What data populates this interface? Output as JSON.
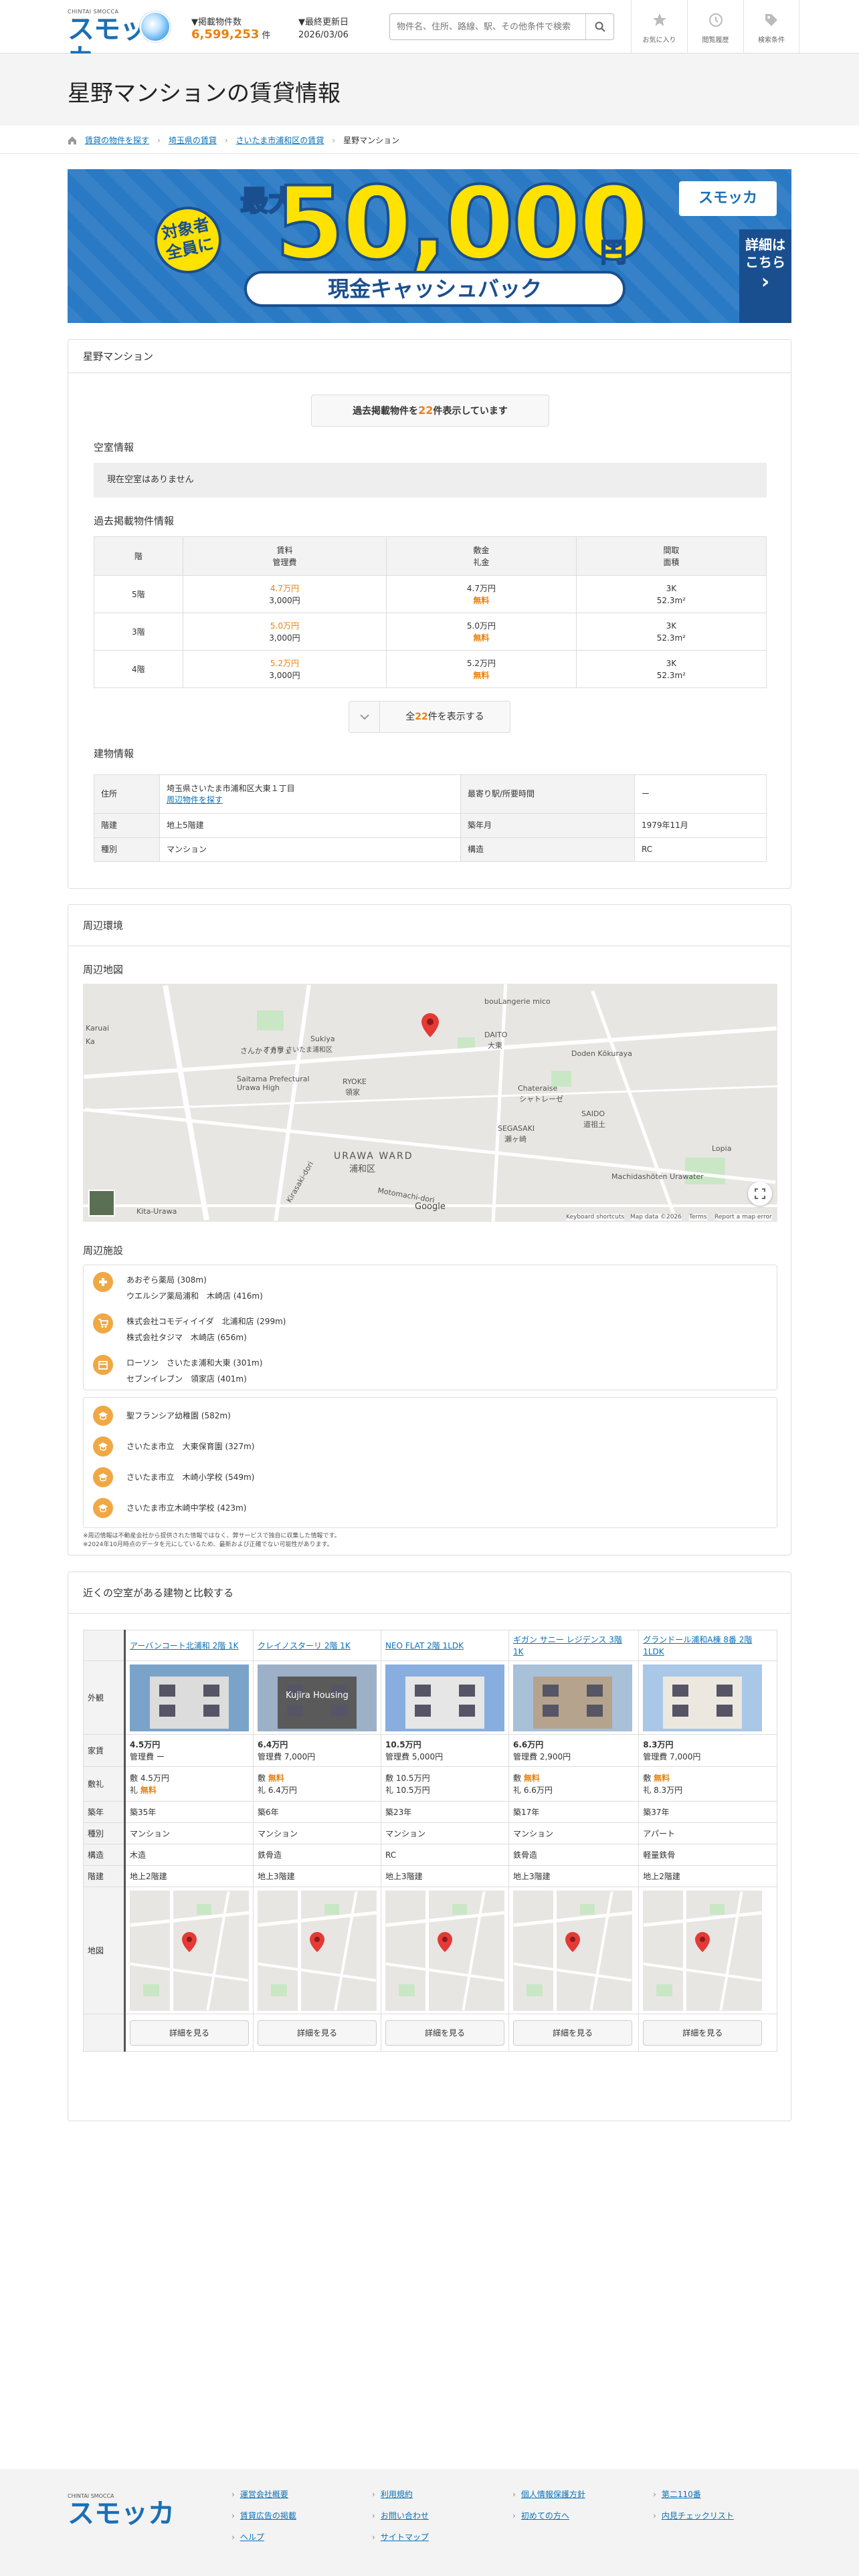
{
  "header": {
    "logo_small": "CHINTAI SMOCCA",
    "logo_text": "スモッカ",
    "count_label": "▼掲載物件数",
    "count_value": "6,599,253",
    "count_unit": "件",
    "updated_label": "▼最終更新日",
    "updated_date": "2026/03/06",
    "search_placeholder": "物件名、住所、路線、駅、その他条件で検索",
    "btn_favorites": "お気に入り",
    "btn_history": "閲覧履歴",
    "btn_conditions": "検索条件"
  },
  "page_title": "星野マンションの賃貸情報",
  "breadcrumb": [
    "賃貸の物件を探す",
    "埼玉県の賃貸",
    "さいたま市浦和区の賃貸",
    "星野マンション"
  ],
  "banner": {
    "badge": "対象者\n全員に",
    "max": "最大",
    "amount": "50,000",
    "yen": "円",
    "cash": "現金キャッシュバック",
    "logo": "スモッカ",
    "more": "詳細は\nこちら"
  },
  "building": {
    "title": "星野マンション",
    "past_pre": "過去掲載物件を",
    "past_count": "22",
    "past_post": "件表示しています",
    "vacancy_heading": "空室情報",
    "no_vacancy": "現在空室はありません",
    "past_heading": "過去掲載物件情報",
    "table_headers": [
      [
        "階"
      ],
      [
        "賃料",
        "管理費"
      ],
      [
        "敷金",
        "礼金"
      ],
      [
        "間取",
        "面積"
      ]
    ],
    "rows": [
      {
        "floor": "5階",
        "rent": "4.7万円",
        "fee": "3,000円",
        "deposit": "4.7万円",
        "key": "無料",
        "layout": "3K",
        "area": "52.3m²"
      },
      {
        "floor": "3階",
        "rent": "5.0万円",
        "fee": "3,000円",
        "deposit": "5.0万円",
        "key": "無料",
        "layout": "3K",
        "area": "52.3m²"
      },
      {
        "floor": "4階",
        "rent": "5.2万円",
        "fee": "3,000円",
        "deposit": "5.2万円",
        "key": "無料",
        "layout": "3K",
        "area": "52.3m²"
      }
    ],
    "show_all_pre": "全",
    "show_all_count": "22",
    "show_all_post": "件を表示する",
    "info_heading": "建物情報",
    "info": {
      "address_label": "住所",
      "address": "埼玉県さいたま市浦和区大東１丁目",
      "address_link": "周辺物件を探す",
      "station_label": "最寄り駅/所要時間",
      "station": "ー",
      "floors_label": "階建",
      "floors": "地上5階建",
      "built_label": "築年月",
      "built": "1979年11月",
      "type_label": "種別",
      "type": "マンション",
      "structure_label": "構造",
      "structure": "RC"
    }
  },
  "surroundings": {
    "title": "周辺環境",
    "map_heading": "周辺地図",
    "map_labels": [
      "さんかくカフェ",
      "bouLangerie mico",
      "Sukiya",
      "すき家 さいたま浦和区",
      "DAITO",
      "大東",
      "Saitama Prefectural Urawa High",
      "RYOKE",
      "領家",
      "Doden Kōkuraya",
      "Chateraise",
      "シャトレーゼ",
      "SEGASAKI",
      "瀬ヶ崎",
      "SAIDO",
      "道祖土",
      "URAWA WARD",
      "浦和区",
      "Machidashōten Urawater",
      "Lopia",
      "Google",
      "Keyboard shortcuts",
      "Map data ©2026",
      "Terms",
      "Report a map error",
      "Kita-Urawa",
      "Motomachi-dori",
      "Kirasaki-dori",
      "Karuai",
      "Ka"
    ],
    "poi_heading": "周辺施設",
    "group1": [
      {
        "icon": "pharmacy-icon",
        "lines": [
          "あおぞら薬局 (308m)",
          "ウエルシア薬局浦和　木崎店 (416m)"
        ]
      },
      {
        "icon": "cart-icon",
        "lines": [
          "株式会社コモディイイダ　北浦和店 (299m)",
          "株式会社タジマ　木崎店 (656m)"
        ]
      },
      {
        "icon": "store-icon",
        "lines": [
          "ローソン　さいたま浦和大東 (301m)",
          "セブンイレブン　領家店 (401m)"
        ]
      }
    ],
    "group2": [
      {
        "icon": "school-icon",
        "lines": [
          "聖フランシア幼稚園 (582m)"
        ]
      },
      {
        "icon": "school-icon",
        "lines": [
          "さいたま市立　大東保育園 (327m)"
        ]
      },
      {
        "icon": "school-icon",
        "lines": [
          "さいたま市立　木崎小学校 (549m)"
        ]
      },
      {
        "icon": "school-icon",
        "lines": [
          "さいたま市立木崎中学校 (423m)"
        ]
      }
    ],
    "note1": "※周辺情報は不動産会社から提供された情報ではなく、弊サービスで独自に収集した情報です。",
    "note2": "※2024年10月時点のデータを元にしているため、最新および正確でない可能性があります。"
  },
  "compare": {
    "title": "近くの空室がある建物と比較する",
    "row_labels": [
      "外観",
      "家賃",
      "敷礼",
      "築年",
      "種別",
      "構造",
      "階建",
      "地図"
    ],
    "detail_label": "詳細を見る",
    "buildings": [
      {
        "name": "アーバンコート北浦和 2階 1K",
        "rent": "4.5万円",
        "fee": "管理費 ー",
        "shiki": "4.5万円",
        "rei": "無料",
        "shiki_free": false,
        "rei_free": true,
        "age": "築35年",
        "type": "マンション",
        "struct": "木造",
        "floors": "地上2階建"
      },
      {
        "name": "クレイノスターリ 2階 1K",
        "rent": "6.4万円",
        "fee": "管理費 7,000円",
        "shiki": "無料",
        "rei": "6.4万円",
        "shiki_free": true,
        "rei_free": false,
        "age": "築6年",
        "type": "マンション",
        "struct": "鉄骨造",
        "floors": "地上3階建"
      },
      {
        "name": "NEO FLAT 2階 1LDK",
        "rent": "10.5万円",
        "fee": "管理費 5,000円",
        "shiki": "10.5万円",
        "rei": "10.5万円",
        "shiki_free": false,
        "rei_free": false,
        "age": "築23年",
        "type": "マンション",
        "struct": "RC",
        "floors": "地上3階建"
      },
      {
        "name": "ギガン サニー レジデンス 3階 1K",
        "rent": "6.6万円",
        "fee": "管理費 2,900円",
        "shiki": "無料",
        "rei": "6.6万円",
        "shiki_free": true,
        "rei_free": false,
        "age": "築17年",
        "type": "マンション",
        "struct": "鉄骨造",
        "floors": "地上3階建"
      },
      {
        "name": "グランドール浦和A棟 8番 2階 1LDK",
        "rent": "8.3万円",
        "fee": "管理費 7,000円",
        "shiki": "無料",
        "rei": "8.3万円",
        "shiki_free": true,
        "rei_free": false,
        "age": "築37年",
        "type": "アパート",
        "struct": "軽量鉄骨",
        "floors": "地上2階建"
      }
    ],
    "shiki_prefix": "敷",
    "rei_prefix": "礼",
    "photo_sign": "Kujira Housing"
  },
  "footer": {
    "col1": [
      "運営会社概要",
      "賃貸広告の掲載"
    ],
    "col2": [
      "利用規約",
      "お問い合わせ"
    ],
    "col3": [
      "個人情報保護方針",
      "初めての方へ"
    ],
    "col4": [
      "第二110番",
      "内見チェックリスト"
    ],
    "col5": [
      "ヘルプ",
      "サイトマップ"
    ]
  },
  "colors": {
    "accent": "#e8820e",
    "link": "#0a72b8",
    "brand": "#1b6fb5",
    "banner": "#2979c4"
  }
}
